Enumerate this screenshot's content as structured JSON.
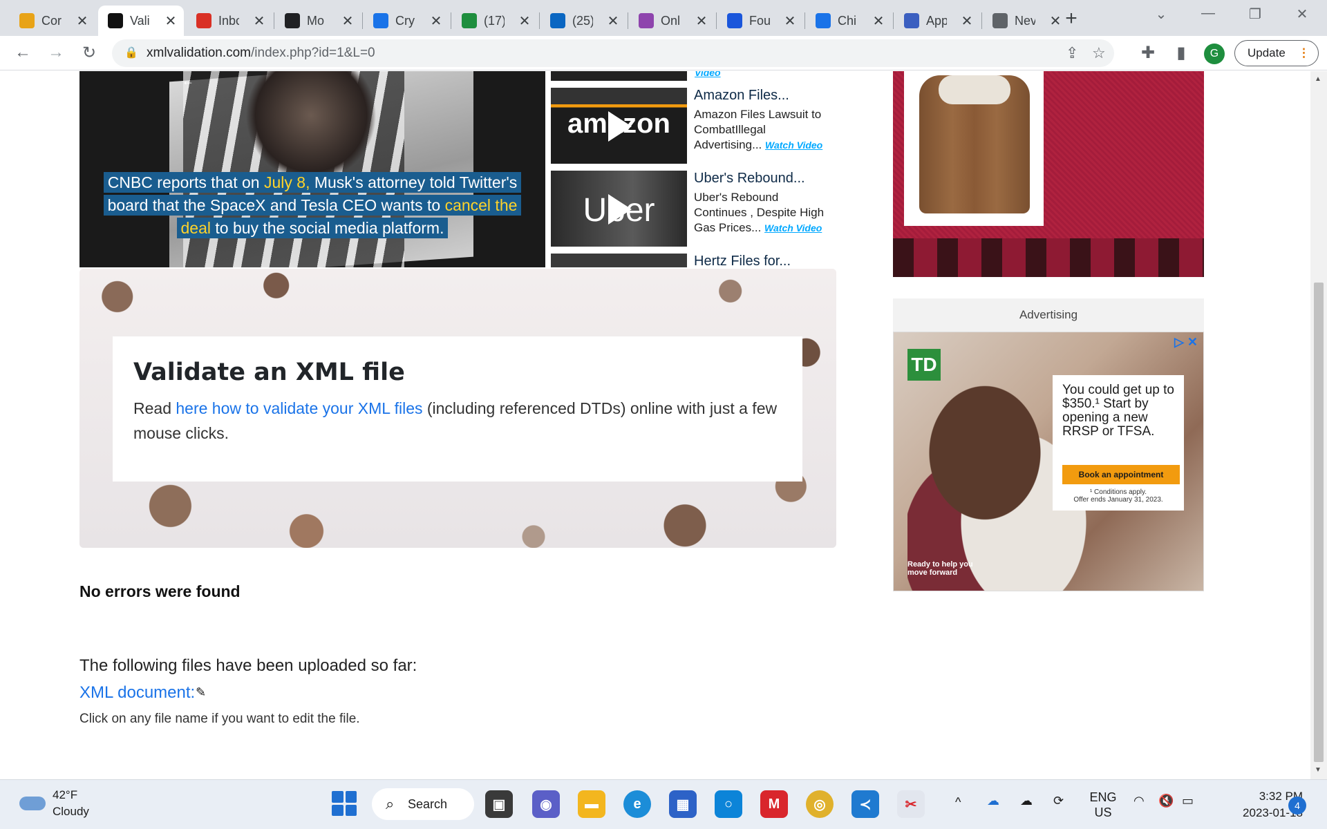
{
  "browser": {
    "tabs": [
      {
        "title": "Cor",
        "icon": "notepad-icon",
        "color": "#e8a317"
      },
      {
        "title": "Vali",
        "icon": "x-tool-icon",
        "color": "#111111",
        "active": true
      },
      {
        "title": "Inbc",
        "icon": "gmail-icon",
        "color": "#d93025"
      },
      {
        "title": "Mo",
        "icon": "chatgpt-icon",
        "color": "#202124"
      },
      {
        "title": "Cry",
        "icon": "messenger-icon",
        "color": "#1a73e8"
      },
      {
        "title": "(17)",
        "icon": "badge-icon",
        "color": "#1e8e3e"
      },
      {
        "title": "(25)",
        "icon": "linkedin-icon",
        "color": "#0a66c2"
      },
      {
        "title": "Onl",
        "icon": "u-icon",
        "color": "#8e44ad"
      },
      {
        "title": "Fou",
        "icon": "c-icon",
        "color": "#1a56db"
      },
      {
        "title": "Chi",
        "icon": "info-icon",
        "color": "#1a73e8"
      },
      {
        "title": "App",
        "icon": "app-icon",
        "color": "#3b5fc0"
      },
      {
        "title": "Nev",
        "icon": "chrome-icon",
        "color": "#5f6368"
      }
    ],
    "url_host": "xmlvalidation.com",
    "url_path": "/index.php?id=1&L=0",
    "profile_initial": "G",
    "update_label": "Update"
  },
  "page": {
    "video_caption": {
      "part1": "CNBC reports that on ",
      "highlight1": "July 8,",
      "part2": " Musk's attorney told Twitter's board that the SpaceX and Tesla CEO wants to ",
      "highlight2": "cancel the deal",
      "part3": " to buy the social media platform."
    },
    "side_videos": {
      "top_link": "Video",
      "items": [
        {
          "title": "Amazon Files...",
          "desc": "Amazon Files Lawsuit to CombatIllegal Advertising...",
          "link": "Watch Video",
          "brand": "amazon"
        },
        {
          "title": "Uber's Rebound...",
          "desc": "Uber's Rebound Continues , Despite High Gas Prices...",
          "link": "Watch Video",
          "brand": "Uber"
        },
        {
          "title": "Hertz Files for...",
          "desc": "",
          "link": "",
          "brand": ""
        }
      ]
    },
    "hero": {
      "title": "Validate an XML file",
      "text_before": "Read ",
      "link": "here how to validate your XML files",
      "text_after": " (including referenced DTDs) online with just a few mouse clicks."
    },
    "status": "No errors were found",
    "files_intro": "The following files have been uploaded so far:",
    "file_link": "XML document:",
    "files_hint": "Click on any file name if you want to edit the file.",
    "ad": {
      "label": "Advertising",
      "logo": "TD",
      "copy": "You could get up to $350.¹ Start by opening a new RRSP or TFSA.",
      "button": "Book an appointment",
      "fine1": "¹ Conditions apply.",
      "fine2": "Offer ends January 31, 2023.",
      "tagline": "Ready to help you move forward"
    }
  },
  "taskbar": {
    "temp": "42°F",
    "condition": "Cloudy",
    "search_label": "Search",
    "lang1": "ENG",
    "lang2": "US",
    "time": "3:32 PM",
    "date": "2023-01-18",
    "notifications": "4"
  }
}
